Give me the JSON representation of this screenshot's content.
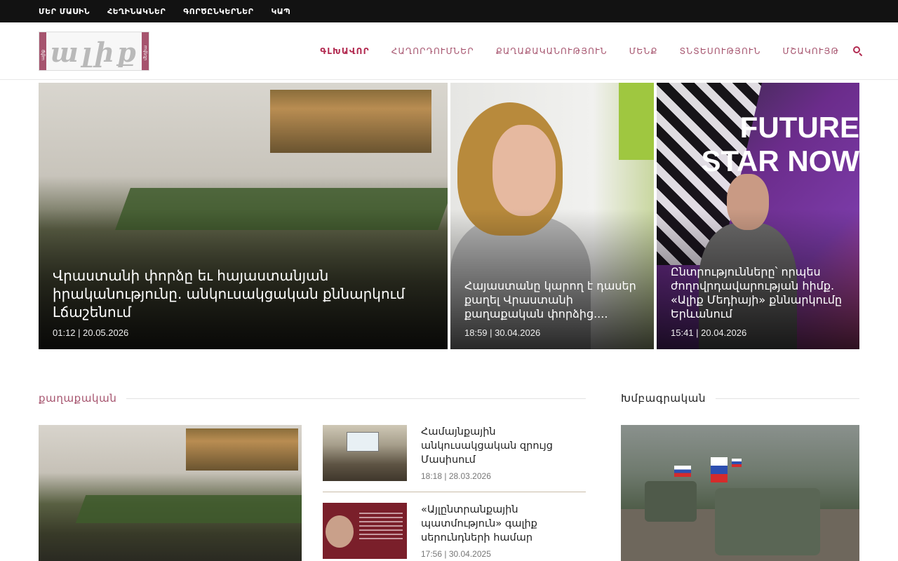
{
  "topbar": {
    "items": [
      "ՄԵՐ ՄԱՍԻՆ",
      "ՀԵՂԻՆԱԿՆԵՐ",
      "ԳՈՐԾԸՆԿԵՐՆԵՐ",
      "ԿԱՊ"
    ]
  },
  "header": {
    "logo_text": "ալիք",
    "logo_side_left": "ալիք",
    "logo_side_right": "մեդիա",
    "nav": [
      "ԳԼԽԱՎՈՐ",
      "ՀԱՂՈՐԴՈՒՄՆԵՐ",
      "ՔԱՂԱՔԱԿԱՆՈՒԹՅՈՒՆ",
      "ՄԵՆՔ",
      "ՏՆՏԵՍՈՒԹՅՈՒՆ",
      "ՄՇԱԿՈՒՅԹ"
    ],
    "active_nav": "ԳԼԽԱՎՈՐ",
    "search_icon": "search-icon"
  },
  "hero": [
    {
      "title": "Վրաստանի փորձը եւ հայաստանյան իրականությունը. անկուսակցական քննարկում Լճաշենում",
      "date": "01:12 | 20.05.2026"
    },
    {
      "title": "Հայաստանը կարող է դասեր քաղել Վրաստանի քաղաքական փորձից....",
      "date": "18:59 | 30.04.2026"
    },
    {
      "title": "Ընտրությունները՝ որպես ժողովրդավարության հիմք. «Ալիք Մեդիայի» քննարկումը Երևանում",
      "date": "15:41 | 20.04.2026",
      "image_text": "FUTURE STAR NOW"
    }
  ],
  "sections": {
    "politics_title": "քաղաքական",
    "editorial_title": "Խմբագրական"
  },
  "politics_list": [
    {
      "title": "Համայնքային անկուսակցական զրույց Մասիսում",
      "date": "18:18 | 28.03.2026"
    },
    {
      "title": "«Այլընտրանքային պատմություն» գալիք սերունդների համար",
      "date": "17:56 | 30.04.2025"
    }
  ],
  "colors": {
    "accent": "#b22a50",
    "nav_text": "#a6546e",
    "topbar_bg": "#121212"
  }
}
